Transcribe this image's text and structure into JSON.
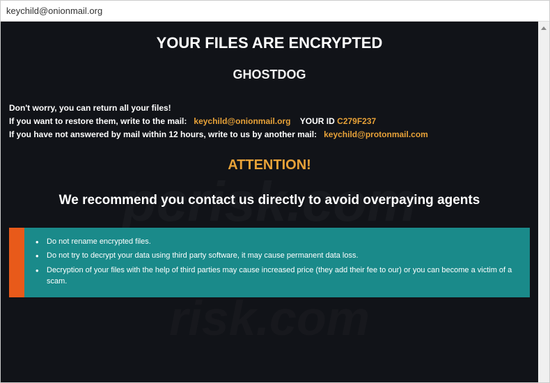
{
  "window": {
    "title": "keychild@onionmail.org"
  },
  "headline": "YOUR FILES ARE ENCRYPTED",
  "group_name": "GHOSTDOG",
  "info": {
    "line1": "Don't worry, you can return all your files!",
    "line2_a": "If you want to restore them, write to the mail:",
    "email1": "keychild@onionmail.org",
    "id_label": "YOUR ID",
    "id_value": "C279F237",
    "line3_a": "If you have not answered by mail within 12 hours, write to us by another mail:",
    "email2": "keychild@protonmail.com"
  },
  "attention": "ATTENTION!",
  "recommend": "We recommend you contact us directly to avoid overpaying agents",
  "warnings": {
    "item1": "Do not rename encrypted files.",
    "item2": "Do not try to decrypt your data using third party software, it may cause permanent data loss.",
    "item3": "Decryption of your files with the help of third parties may cause increased price (they add their fee to our) or you can become a victim of a scam."
  }
}
